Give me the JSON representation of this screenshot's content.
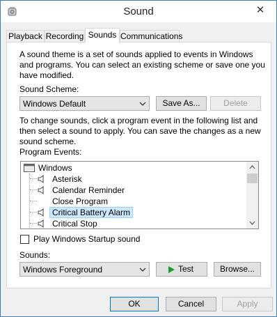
{
  "window": {
    "title": "Sound",
    "close_glyph": "✕"
  },
  "tabs": [
    {
      "label": "Playback",
      "active": false
    },
    {
      "label": "Recording",
      "active": false
    },
    {
      "label": "Sounds",
      "active": true
    },
    {
      "label": "Communications",
      "active": false
    }
  ],
  "intro_lines": [
    "A sound theme is a set of sounds applied to events in Windows",
    "and programs.  You can select an existing scheme or save one you",
    "have modified."
  ],
  "scheme": {
    "label": "Sound Scheme:",
    "value": "Windows Default",
    "save_as": "Save As...",
    "delete": "Delete"
  },
  "instruction_lines": [
    "To change sounds, click a program event in the following list and",
    "then select a sound to apply.  You can save the changes as a new",
    "sound scheme."
  ],
  "events": {
    "label": "Program Events:",
    "root": "Windows",
    "items": [
      {
        "label": "Asterisk",
        "has_sound": true,
        "selected": false
      },
      {
        "label": "Calendar Reminder",
        "has_sound": true,
        "selected": false
      },
      {
        "label": "Close Program",
        "has_sound": false,
        "selected": false
      },
      {
        "label": "Critical Battery Alarm",
        "has_sound": true,
        "selected": true
      },
      {
        "label": "Critical Stop",
        "has_sound": true,
        "selected": false
      }
    ]
  },
  "startup": {
    "label": "Play Windows Startup sound",
    "checked": false
  },
  "sounds": {
    "label": "Sounds:",
    "value": "Windows Foreground",
    "test": "Test",
    "browse": "Browse..."
  },
  "footer": {
    "ok": "OK",
    "cancel": "Cancel",
    "apply": "Apply"
  },
  "colors": {
    "accent": "#0078d7",
    "selection_bg": "#cce8ff",
    "selection_border": "#99d1ff",
    "play_green": "#1a9e2c"
  }
}
